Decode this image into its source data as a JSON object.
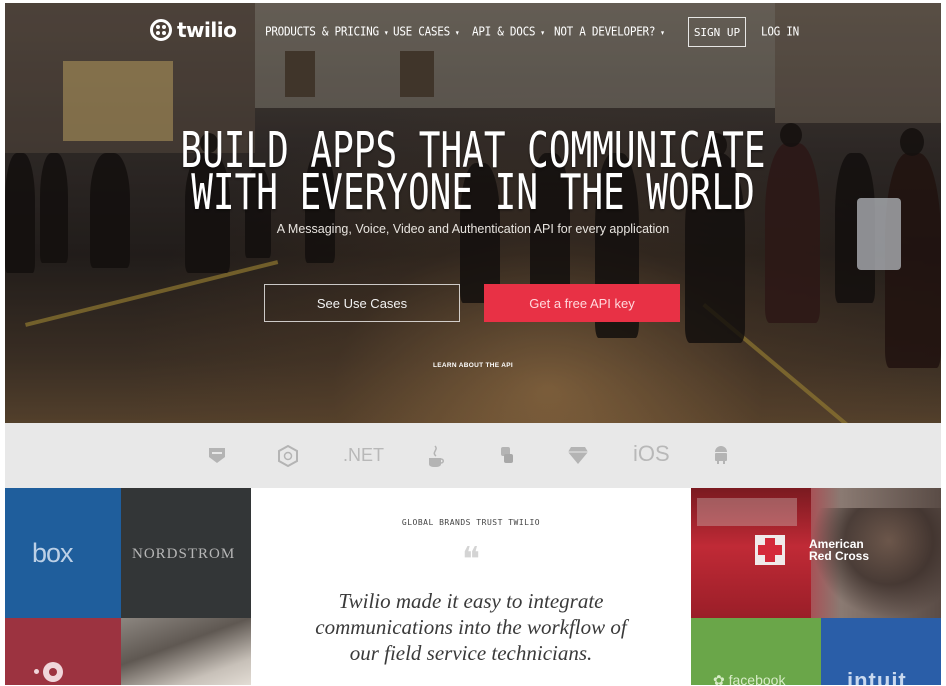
{
  "nav": {
    "logo_text": "twilio",
    "items": [
      {
        "label": "PRODUCTS & PRICING",
        "caret": "▾"
      },
      {
        "label": "USE CASES",
        "caret": "▾"
      },
      {
        "label": "API & DOCS",
        "caret": "▾"
      },
      {
        "label": "NOT A DEVELOPER?",
        "caret": "▾"
      }
    ],
    "signup_label": "SIGN UP",
    "login_label": "LOG IN"
  },
  "hero": {
    "headline_line1": "BUILD APPS THAT COMMUNICATE",
    "headline_line2": "WITH EVERYONE IN THE WORLD",
    "subheadline": "A Messaging, Voice, Video and Authentication API for every application",
    "secondary_button": "See Use Cases",
    "primary_button": "Get a free API key",
    "learn_link": "LEARN ABOUT THE API"
  },
  "platforms": [
    {
      "name": "php",
      "icon": "php-badge-icon"
    },
    {
      "name": "node",
      "icon": "nodejs-hexagon-icon"
    },
    {
      "name": ".NET",
      "label": ".NET",
      "icon": "dotnet-icon"
    },
    {
      "name": "java",
      "icon": "java-cup-icon"
    },
    {
      "name": "python",
      "icon": "python-icon"
    },
    {
      "name": "ruby",
      "icon": "ruby-icon"
    },
    {
      "name": "iOS",
      "label": "iOS",
      "icon": "ios-icon"
    },
    {
      "name": "android",
      "icon": "android-icon"
    }
  ],
  "customers": {
    "box": "box",
    "nordstrom": "NORDSTROM",
    "red_cross_line1": "American",
    "red_cross_line2": "Red Cross",
    "green_brand": "✿ facebook",
    "intuit": "intuit"
  },
  "testimonial": {
    "label": "GLOBAL BRANDS TRUST TWILIO",
    "quote_mark": "❝",
    "quote_line1": "Twilio made it easy to integrate",
    "quote_line2": "communications into the workflow of",
    "quote_line3": "our field service technicians."
  },
  "colors": {
    "accent_red": "#e83145",
    "box_blue": "#1f5e9c",
    "nordstrom_dark": "#333637",
    "strip_gray": "#e8e8e8"
  }
}
